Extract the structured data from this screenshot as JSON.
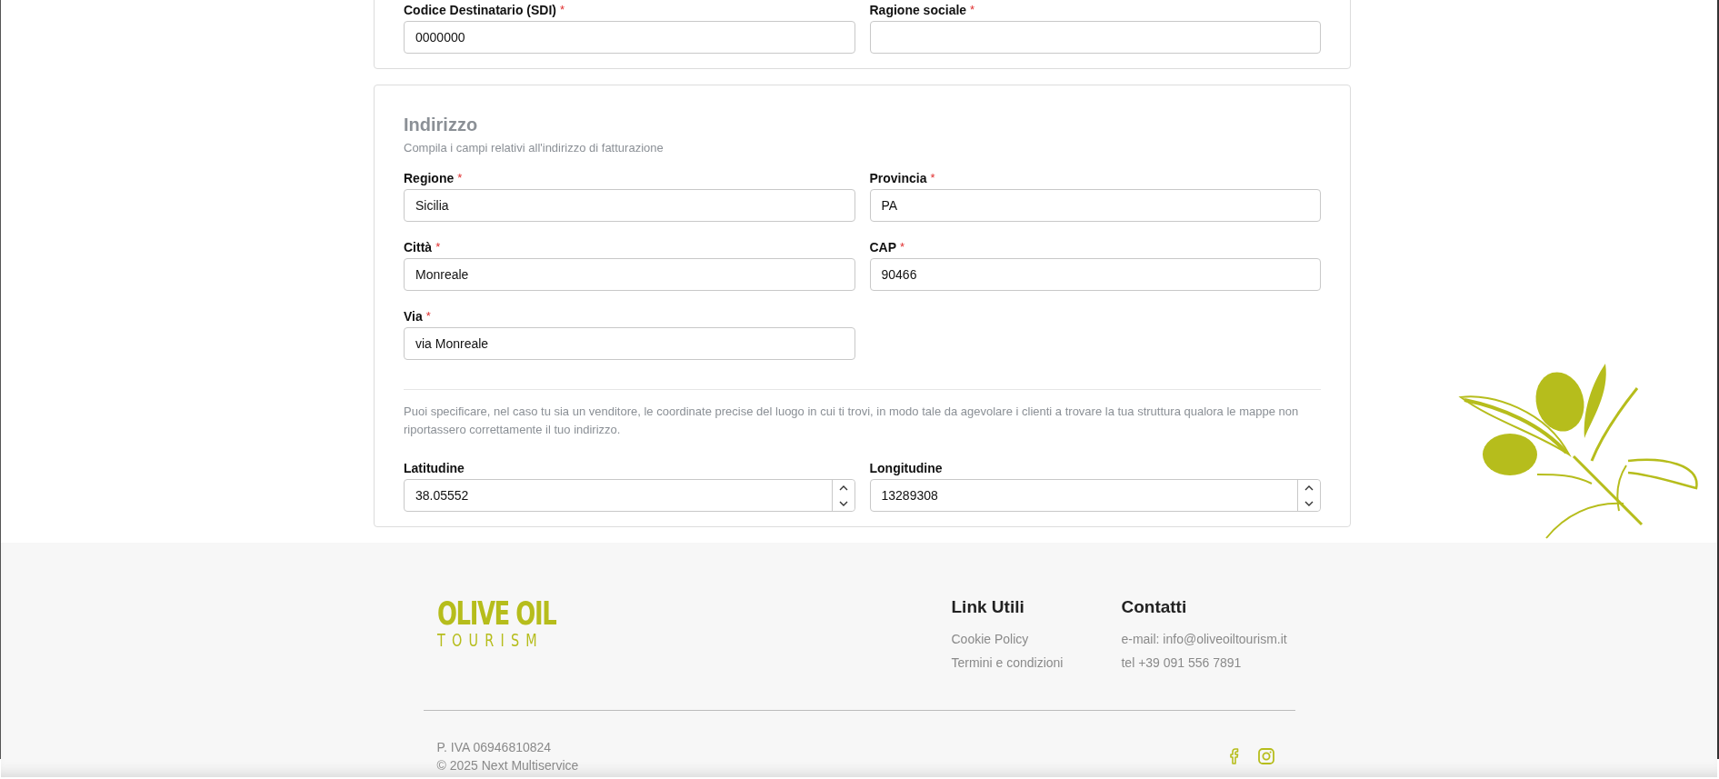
{
  "sections": [
    {
      "groups": [
        {
          "fields": [
            {
              "label": "Codice Destinatario (SDI)",
              "required_mark": "*",
              "value": "0000000",
              "kind": "text"
            },
            {
              "label": "Ragione sociale",
              "required_mark": "*",
              "kind": "text"
            }
          ]
        }
      ]
    },
    {
      "title": "Indirizzo",
      "subtitle": "Compila i campi relativi all'indirizzo di fatturazione",
      "groups": [
        {
          "fields": [
            {
              "label": "Regione",
              "required_mark": "*",
              "value": "Sicilia",
              "kind": "text"
            },
            {
              "label": "Provincia",
              "required_mark": "*",
              "value": "PA",
              "kind": "text"
            },
            {
              "label": "Città",
              "required_mark": "*",
              "value": "Monreale",
              "kind": "text"
            },
            {
              "label": "CAP",
              "required_mark": "*",
              "value": "90466",
              "kind": "text"
            },
            {
              "label": "Via",
              "required_mark": "*",
              "value": "via Monreale",
              "kind": "text"
            }
          ]
        },
        {
          "note": "Puoi specificare, nel caso tu sia un venditore, le coordinate precise del luogo in cui ti trovi, in modo tale da agevolare i clienti a trovare la tua struttura qualora le mappe non riportassero correttamente il tuo indirizzo.",
          "fields": [
            {
              "label": "Latitudine",
              "value": "38.05552",
              "kind": "number"
            },
            {
              "label": "Longitudine",
              "value": "13289308",
              "kind": "number"
            }
          ]
        }
      ]
    }
  ],
  "footer": {
    "logo": {
      "line_1": "OLIVE OIL",
      "line_2": "TOURISM"
    },
    "columns": [
      {
        "title": "Link Utili",
        "items": [
          "Cookie Policy",
          "Termini e condizioni"
        ]
      },
      {
        "title": "Contatti",
        "items": [
          "e-mail: info@oliveoiltourism.it",
          "tel +39 091 556 7891"
        ]
      }
    ],
    "vat": "P. IVA 06946810824",
    "copyright": "© 2025 Next Multiservice",
    "social": [
      {
        "kind": "facebook"
      },
      {
        "kind": "instagram"
      }
    ]
  }
}
